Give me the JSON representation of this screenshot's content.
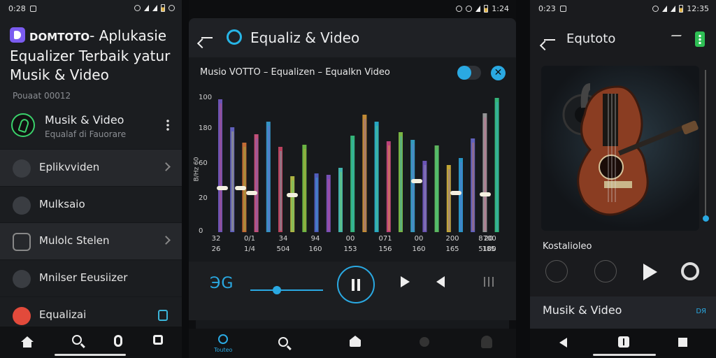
{
  "screen_left": {
    "status": {
      "time": "0:28"
    },
    "title_badge": "DOMTOTO",
    "title_rest": "- Aplukasie Equalizer Terbaik yatur Musik & Video",
    "subtitle": "Pouaat 00012",
    "card": {
      "title": "Musik & Video",
      "subtitle": "Equalaf di Fauorare"
    },
    "menu": [
      {
        "label": "Eplikvviden"
      },
      {
        "label": "Mulksaio"
      },
      {
        "label": "Mulolc Stelen"
      },
      {
        "label": "Mnilser Eeusiizer"
      },
      {
        "label": "Equalizai"
      }
    ]
  },
  "screen_mid": {
    "status": {
      "time": "1:24"
    },
    "title": "Equaliz & Video",
    "panel_title": "Musio VOTTO – Equalizen – Equalkn Video",
    "y_ticks": [
      "100",
      "180",
      "60",
      "20",
      "0"
    ],
    "y_label": "B/Hz 60",
    "x_labels": [
      {
        "top": "32",
        "bot": "26"
      },
      {
        "top": "0/1",
        "bot": "1/4"
      },
      {
        "top": "34",
        "bot": "504"
      },
      {
        "top": "94",
        "bot": "160"
      },
      {
        "top": "00",
        "bot": "153"
      },
      {
        "top": "071",
        "bot": "156"
      },
      {
        "top": "00",
        "bot": "160"
      },
      {
        "top": "200",
        "bot": "165"
      },
      {
        "top": "20",
        "bot": "185"
      },
      {
        "top": "8700",
        "bot": "5100"
      }
    ],
    "close_symbol": "✕",
    "time": "ЭG",
    "nav_label": "Touteo"
  },
  "screen_right": {
    "status": {
      "time": "0:23",
      "time_right": "12:35"
    },
    "title": "Equtoto",
    "label": "Kostalioleo",
    "section_title": "Musik & Video",
    "section_icon_text": "DЯ"
  },
  "colors": {
    "accent": "#2aa9e2",
    "green": "#3ad16b",
    "bg": "#1b1d20"
  }
}
